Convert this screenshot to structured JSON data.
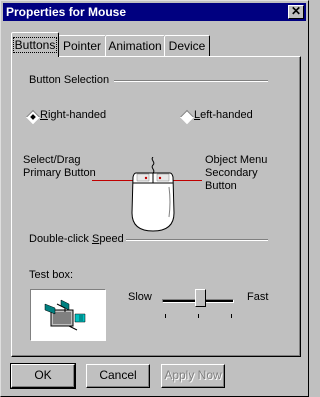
{
  "window": {
    "title": "Properties for Mouse",
    "close_glyph": "✕"
  },
  "tabs": [
    {
      "label": "Buttons",
      "active": true
    },
    {
      "label": "Pointer",
      "active": false
    },
    {
      "label": "Animation",
      "active": false
    },
    {
      "label": "Device",
      "active": false
    }
  ],
  "button_selection": {
    "group_label": "Button Selection",
    "right_handed": {
      "first_letter": "R",
      "rest": "ight-handed",
      "selected": true
    },
    "left_handed": {
      "first_letter": "L",
      "rest": "eft-handed",
      "selected": false
    },
    "left_desc_line1": "Select/Drag",
    "left_desc_line2": "Primary Button",
    "right_desc_line1": "Object Menu",
    "right_desc_line2": "Secondary",
    "right_desc_line3": "Button"
  },
  "double_click": {
    "group_label_prefix": "Double-click ",
    "group_label_accel": "S",
    "group_label_rest": "peed",
    "test_box_label": "Test box:",
    "slow_label": "Slow",
    "fast_label": "Fast",
    "speed_fraction": 0.5
  },
  "buttons": {
    "ok": "OK",
    "cancel": "Cancel",
    "apply": "Apply Now"
  },
  "colors": {
    "title_bar": "#000080",
    "face": "#c0c0c0",
    "pointer_line": "#c00000"
  }
}
